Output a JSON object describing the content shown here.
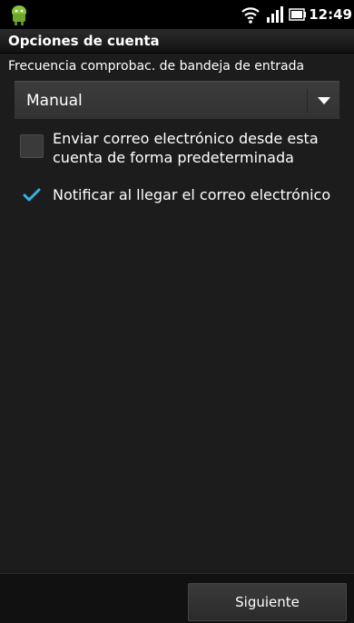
{
  "status_bar": {
    "time": "12:49",
    "icons": [
      "android-notification-icon",
      "wifi-icon",
      "signal-icon",
      "battery-icon"
    ]
  },
  "header": {
    "title": "Opciones de cuenta"
  },
  "inbox_check": {
    "label": "Frecuencia comprobac. de bandeja de entrada",
    "selected_value": "Manual"
  },
  "options": {
    "default_account": {
      "label": "Enviar correo electrónico desde esta cuenta de forma predeterminada",
      "checked": false
    },
    "notify": {
      "label": "Notificar al llegar el correo electrónico",
      "checked": true
    }
  },
  "footer": {
    "next_label": "Siguiente"
  },
  "colors": {
    "accent": "#33b5e5",
    "background": "#1c1c1c",
    "status_bar": "#000000"
  }
}
